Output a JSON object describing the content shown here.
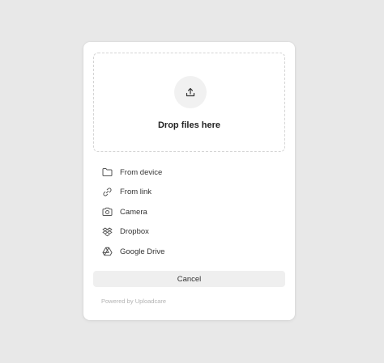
{
  "dropzone": {
    "title": "Drop files here",
    "icon": "upload-icon"
  },
  "sources": [
    {
      "label": "From device",
      "icon": "folder-icon"
    },
    {
      "label": "From link",
      "icon": "link-icon"
    },
    {
      "label": "Camera",
      "icon": "camera-icon"
    },
    {
      "label": "Dropbox",
      "icon": "dropbox-icon"
    },
    {
      "label": "Google Drive",
      "icon": "google-drive-icon"
    }
  ],
  "actions": {
    "cancel_label": "Cancel"
  },
  "footer": {
    "powered_by": "Powered by Uploadcare"
  },
  "colors": {
    "background": "#e8e8e8",
    "dialog": "#ffffff",
    "icon_stroke": "#555555",
    "muted_text": "#b3b3b3"
  }
}
